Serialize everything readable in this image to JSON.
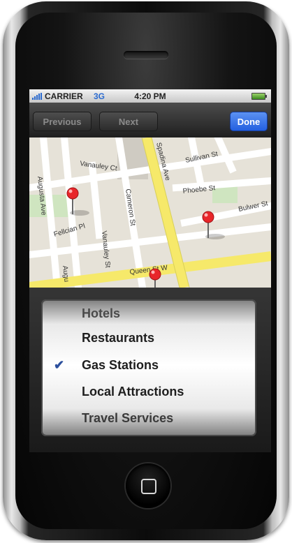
{
  "status_bar": {
    "carrier": "CARRIER",
    "network": "3G",
    "time": "4:20 PM"
  },
  "toolbar": {
    "previous_label": "Previous",
    "next_label": "Next",
    "done_label": "Done"
  },
  "map": {
    "streets": [
      "Spadina Ave",
      "Sullivan St",
      "Augusta Ave",
      "Vanauley Ct",
      "Cameron St",
      "Phoebe St",
      "Bulwer St",
      "Fellcian Pl",
      "Vanauley St",
      "Queen St W",
      "Augu"
    ],
    "pin_count": 3
  },
  "picker": {
    "options": [
      "Hotels",
      "Restaurants",
      "Gas Stations",
      "Local Attractions",
      "Travel Services"
    ],
    "selected": "Gas Stations"
  },
  "colors": {
    "done_button": "#2f6ee6",
    "checkmark": "#2c4f9d",
    "pin": "#e8262a"
  }
}
